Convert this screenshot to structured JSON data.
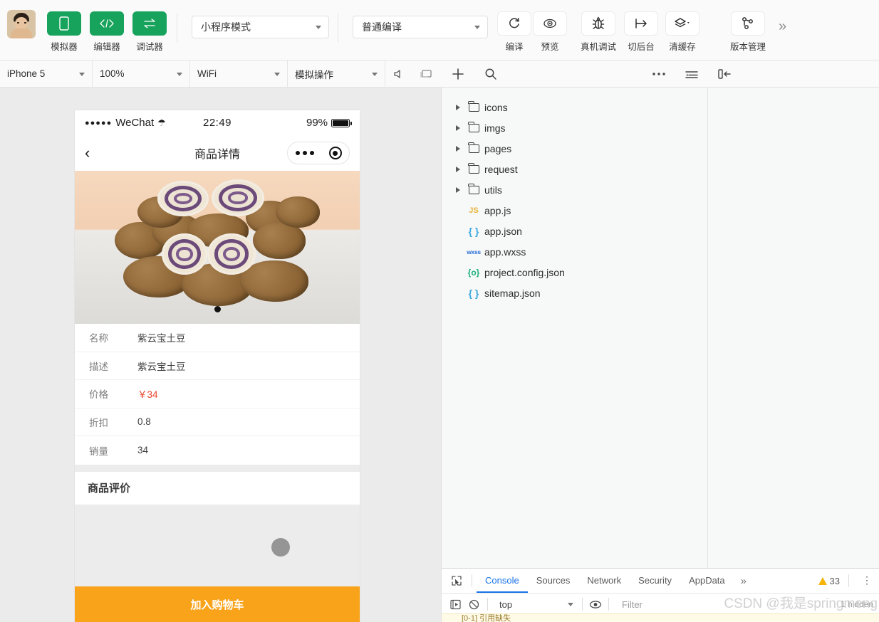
{
  "toolbar": {
    "avatar_name": "user-avatar",
    "buttons": [
      {
        "label": "模拟器",
        "icon": "phone-icon",
        "style": "green"
      },
      {
        "label": "编辑器",
        "icon": "code-icon",
        "style": "green"
      },
      {
        "label": "调试器",
        "icon": "debugger-icon",
        "style": "green"
      }
    ],
    "mode_select": {
      "value": "小程序模式"
    },
    "compile_select": {
      "value": "普通编译"
    },
    "actions": [
      {
        "label": "编译",
        "icon": "refresh-icon"
      },
      {
        "label": "预览",
        "icon": "preview-eye-icon"
      },
      {
        "label": "真机调试",
        "icon": "bug-icon"
      },
      {
        "label": "切后台",
        "icon": "background-icon"
      },
      {
        "label": "清缓存",
        "icon": "layers-icon"
      },
      {
        "label": "版本管理",
        "icon": "git-branch-icon"
      }
    ],
    "overflow": "»"
  },
  "simulator_bar": {
    "device": "iPhone 5",
    "zoom": "100%",
    "network": "WiFi",
    "operation": "模拟操作",
    "mute_icon": "mute-icon",
    "screen_icon": "screen-icon"
  },
  "devtools_bar": {
    "add_icon": "plus-icon",
    "search_icon": "search-icon",
    "more_icon": "ellipsis-icon",
    "outline_icon": "outline-icon",
    "panel_icon": "panel-toggle-icon"
  },
  "phone": {
    "status": {
      "carrier": "WeChat",
      "signal_dots": "●●●●●",
      "time": "22:49",
      "battery_pct": "99%"
    },
    "nav": {
      "back_icon": "chevron-left-icon",
      "title": "商品详情",
      "capsule_menu": "capsule-menu-icon",
      "capsule_target": "capsule-target-icon"
    },
    "product_image_alt": "紫云宝土豆 product photo",
    "details": [
      {
        "key": "名称",
        "value": "紫云宝土豆",
        "type": "text"
      },
      {
        "key": "描述",
        "value": "紫云宝土豆",
        "type": "text"
      },
      {
        "key": "价格",
        "value": "￥34",
        "type": "price"
      },
      {
        "key": "折扣",
        "value": "0.8",
        "type": "text"
      },
      {
        "key": "销量",
        "value": "34",
        "type": "text"
      }
    ],
    "review_title": "商品评价",
    "cart_button": "加入购物车",
    "accent_orange": "#f9a31b",
    "price_color": "#e8442a"
  },
  "file_tree": {
    "folders": [
      {
        "name": "icons"
      },
      {
        "name": "imgs"
      },
      {
        "name": "pages"
      },
      {
        "name": "request"
      },
      {
        "name": "utils"
      }
    ],
    "files": [
      {
        "name": "app.js",
        "icon": "js-file-icon",
        "badge": "JS",
        "kind": "js"
      },
      {
        "name": "app.json",
        "icon": "json-file-icon",
        "badge": "{ }",
        "kind": "json"
      },
      {
        "name": "app.wxss",
        "icon": "wxss-file-icon",
        "badge": "wxss",
        "kind": "wxss"
      },
      {
        "name": "project.config.json",
        "icon": "config-file-icon",
        "badge": "{o}",
        "kind": "cfg"
      },
      {
        "name": "sitemap.json",
        "icon": "json-file-icon",
        "badge": "{ }",
        "kind": "json"
      }
    ]
  },
  "console": {
    "inspect_icon": "inspect-element-icon",
    "tabs": [
      {
        "label": "Console",
        "active": true
      },
      {
        "label": "Sources",
        "active": false
      },
      {
        "label": "Network",
        "active": false
      },
      {
        "label": "Security",
        "active": false
      },
      {
        "label": "AppData",
        "active": false
      }
    ],
    "more_tabs": "»",
    "warning_count": "33",
    "kebab": "⋮",
    "execute_icon": "execute-icon",
    "clear_icon": "clear-console-icon",
    "context": "top",
    "eye_icon": "eye-icon",
    "filter_placeholder": "Filter",
    "hidden_label": "1 hidden",
    "message_line": "[0-1] 引用缺失"
  },
  "watermark": "CSDN @我是springmeng"
}
